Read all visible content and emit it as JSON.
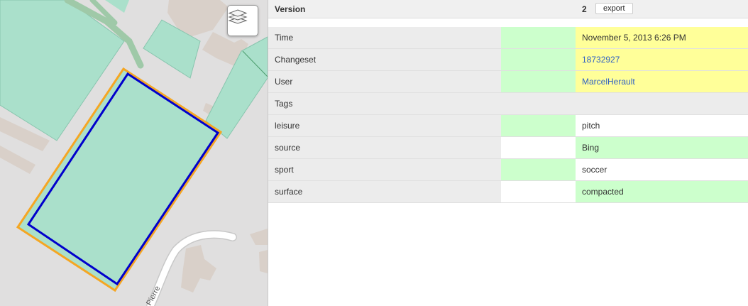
{
  "map": {
    "street_label": "Pierre",
    "layers_button": "layers-icon",
    "colors": {
      "background": "#e0dfdf",
      "pitch_fill": "#aae0cb",
      "pitch_border": "#88c5ae",
      "building": "#d9d0c9",
      "previous_outline": "#f5a623",
      "current_outline": "#0000cc",
      "road": "#ffffff",
      "path": "#9fc9a8"
    }
  },
  "panel": {
    "header": {
      "title": "Version",
      "version": "2",
      "export_label": "export"
    },
    "rows": [
      {
        "key": "Time",
        "value": "November 5, 2013 6:26 PM",
        "mid": "green",
        "val": "yellow",
        "link": false
      },
      {
        "key": "Changeset",
        "value": "18732927",
        "mid": "green",
        "val": "yellow",
        "link": true
      },
      {
        "key": "User",
        "value": "MarcelHerault",
        "mid": "green",
        "val": "yellow",
        "link": true
      },
      {
        "key": "Tags",
        "value": "",
        "mid": "grey",
        "val": "grey",
        "link": false
      },
      {
        "key": "leisure",
        "value": "pitch",
        "mid": "green",
        "val": "white",
        "link": false
      },
      {
        "key": "source",
        "value": "Bing",
        "mid": "white",
        "val": "green",
        "link": false
      },
      {
        "key": "sport",
        "value": "soccer",
        "mid": "green",
        "val": "white",
        "link": false
      },
      {
        "key": "surface",
        "value": "compacted",
        "mid": "white",
        "val": "green",
        "link": false
      }
    ]
  }
}
